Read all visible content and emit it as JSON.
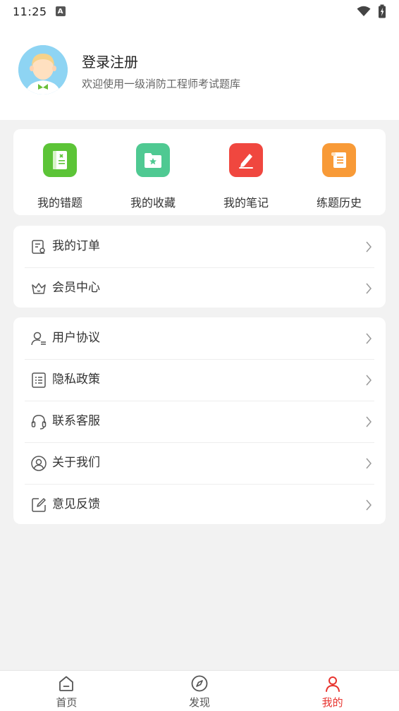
{
  "status_bar": {
    "time": "11:25",
    "notification_icon": "A"
  },
  "profile": {
    "title": "登录注册",
    "subtitle": "欢迎使用一级消防工程师考试题库"
  },
  "quick_actions": [
    {
      "label": "我的错题",
      "icon": "wrong-questions-icon",
      "color": "#5cc437"
    },
    {
      "label": "我的收藏",
      "icon": "favorites-folder-icon",
      "color": "#4fc992"
    },
    {
      "label": "我的笔记",
      "icon": "notes-pen-icon",
      "color": "#f0473f"
    },
    {
      "label": "练题历史",
      "icon": "history-scroll-icon",
      "color": "#f89a37"
    }
  ],
  "menu_group_1": [
    {
      "label": "我的订单",
      "icon": "order-icon"
    },
    {
      "label": "会员中心",
      "icon": "crown-icon"
    }
  ],
  "menu_group_2": [
    {
      "label": "用户协议",
      "icon": "user-agreement-icon"
    },
    {
      "label": "隐私政策",
      "icon": "privacy-list-icon"
    },
    {
      "label": "联系客服",
      "icon": "headset-icon"
    },
    {
      "label": "关于我们",
      "icon": "about-user-icon"
    },
    {
      "label": "意见反馈",
      "icon": "feedback-edit-icon"
    }
  ],
  "bottom_nav": [
    {
      "label": "首页",
      "icon": "home-icon"
    },
    {
      "label": "发现",
      "icon": "compass-icon"
    },
    {
      "label": "我的",
      "icon": "profile-icon",
      "active": true
    }
  ],
  "colors": {
    "accent": "#e8342f",
    "background": "#f2f2f2"
  }
}
